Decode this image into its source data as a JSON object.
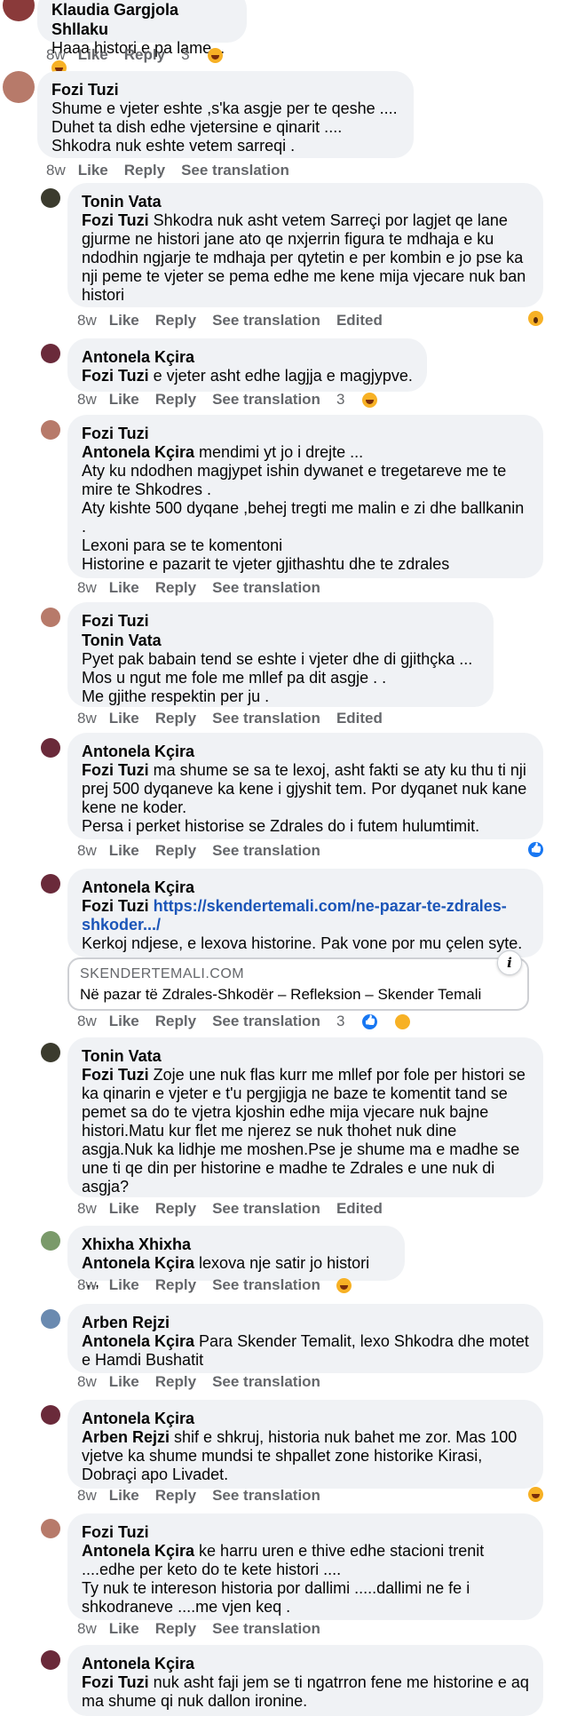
{
  "colors": {
    "bubble": "#f0f2f5",
    "meta": "#65676b",
    "link": "#1b55b8",
    "like_blue": "#1877f2",
    "haha": "#f7b125"
  },
  "actions": {
    "like": "Like",
    "reply": "Reply",
    "see_translation": "See translation",
    "edited": "Edited"
  },
  "comments": [
    {
      "author": "Klaudia Gargjola Shllaku",
      "avatar_color": "#8a3a3a",
      "text": "Haaa histori e pa lame...",
      "time": "8w",
      "reaction_count": "3",
      "reactions": [
        "haha-icon"
      ]
    },
    {
      "author": "Fozi Tuzi",
      "avatar_color": "#b77a6a",
      "text": "Shume e vjeter eshte ,s'ka asgje per te qeshe ....\nDuhet ta dish edhe vjetersine e qinarit ....\nShkodra nuk eshte vetem sarreqi .",
      "time": "8w"
    },
    {
      "author": "Tonin Vata",
      "avatar_color": "#3b3b2e",
      "mention": "Fozi Tuzi",
      "text": "Shkodra nuk asht vetem Sarreçi por lagjet qe lane gjurme ne histori jane ato qe nxjerrin figura te mdhaja e ku ndodhin ngjarje te mdhaja per qytetin e per kombin e jo pse ka nji peme te vjeter se pema edhe me kene mija vjecare nuk ban histori",
      "time": "8w",
      "side_reaction": "wow-icon"
    },
    {
      "author": "Antonela Kçira",
      "avatar_color": "#6a2a3a",
      "mention": "Fozi Tuzi",
      "text": "e vjeter asht edhe lagjja e magjypve.",
      "time": "8w",
      "reaction_count": "3",
      "reactions": [
        "haha-icon"
      ]
    },
    {
      "author": "Fozi Tuzi",
      "avatar_color": "#b77a6a",
      "mention": "Antonela Kçira",
      "text": "mendimi yt jo i drejte ...\nAty ku ndodhen magjypet ishin dywanet e tregetareve me te mire te Shkodres .\nAty kishte 500 dyqane ,behej tregti me malin e zi dhe ballkanin .\nLexoni para se te komentoni\nHistorine e pazarit te vjeter gjithashtu dhe te zdrales",
      "time": "8w"
    },
    {
      "author": "Fozi Tuzi",
      "avatar_color": "#b77a6a",
      "mention": "Tonin Vata",
      "text": "Pyet pak babain tend se eshte i vjeter dhe di gjithçka ...\nMos u ngut me fole me mllef pa dit asgje . .\nMe gjithe respektin per ju .",
      "time": "8w"
    },
    {
      "author": "Antonela Kçira",
      "avatar_color": "#6a2a3a",
      "mention": "Fozi Tuzi",
      "text": "ma shume se sa te lexoj, asht fakti se aty ku thu ti nji prej 500 dyqaneve ka kene i gjyshit tem. Por dyqanet nuk kane kene ne koder.\nPersa i perket historise se Zdrales do i futem hulumtimit.",
      "time": "8w",
      "side_reaction": "like-icon"
    },
    {
      "author": "Antonela Kçira",
      "avatar_color": "#6a2a3a",
      "mention": "Fozi Tuzi",
      "link": "https://skendertemali.com/ne-pazar-te-zdrales-shkoder.../",
      "text": "Kerkoj ndjese, e lexova historine. Pak vone por mu çelen syte.",
      "card_domain": "SKENDERTEMALI.COM",
      "card_title": "Në pazar të Zdrales-Shkodër – Refleksion – Skender Temali",
      "time": "8w",
      "reaction_count": "3",
      "reactions": [
        "like-icon",
        "care-icon"
      ]
    },
    {
      "author": "Tonin Vata",
      "avatar_color": "#3b3b2e",
      "mention": "Fozi Tuzi",
      "text": "Zoje une nuk flas kurr me mllef por fole per histori se ka qinarin e vjeter e t'u pergjigja ne baze te komentit tand se pemet sa do te vjetra kjoshin edhe mija vjecare nuk bajne histori.Matu kur flet me njerez se nuk thohet nuk dine asgja.Nuk ka lidhje me moshen.Pse je shume ma e madhe se une ti qe din per historine e madhe te Zdrales e une nuk di asgja?",
      "time": "8w"
    },
    {
      "author": "Xhixha Xhixha",
      "avatar_color": "#7a9a6a",
      "mention": "Antonela Kçira",
      "text": "lexova nje satir jo histori ,,,,",
      "time": "8w",
      "reactions": [
        "haha-icon"
      ]
    },
    {
      "author": "Arben Rejzi",
      "avatar_color": "#6a8ab0",
      "mention": "Antonela Kçira",
      "text": "Para Skender Temalit, lexo Shkodra dhe motet e Hamdi Bushatit",
      "time": "8w"
    },
    {
      "author": "Antonela Kçira",
      "avatar_color": "#6a2a3a",
      "mention": "Arben Rejzi",
      "text": "shif e shkruj, historia nuk bahet me zor. Mas 100 vjetve ka shume mundsi te shpallet zone historike Kirasi, Dobraçi apo Livadet.",
      "time": "8w",
      "side_reaction": "haha-icon"
    },
    {
      "author": "Fozi Tuzi",
      "avatar_color": "#b77a6a",
      "mention": "Antonela Kçira",
      "text": "ke harru uren e thive edhe stacioni trenit ....edhe per keto do te kete histori ....\nTy nuk te intereson historia por dallimi .....dallimi ne fe i shkodraneve ....me vjen keq .",
      "time": "8w"
    },
    {
      "author": "Antonela Kçira",
      "avatar_color": "#6a2a3a",
      "mention": "Fozi Tuzi",
      "text": "nuk asht faji jem se ti ngatrron fene me historine e aq ma shume qi nuk dallon ironine."
    }
  ]
}
